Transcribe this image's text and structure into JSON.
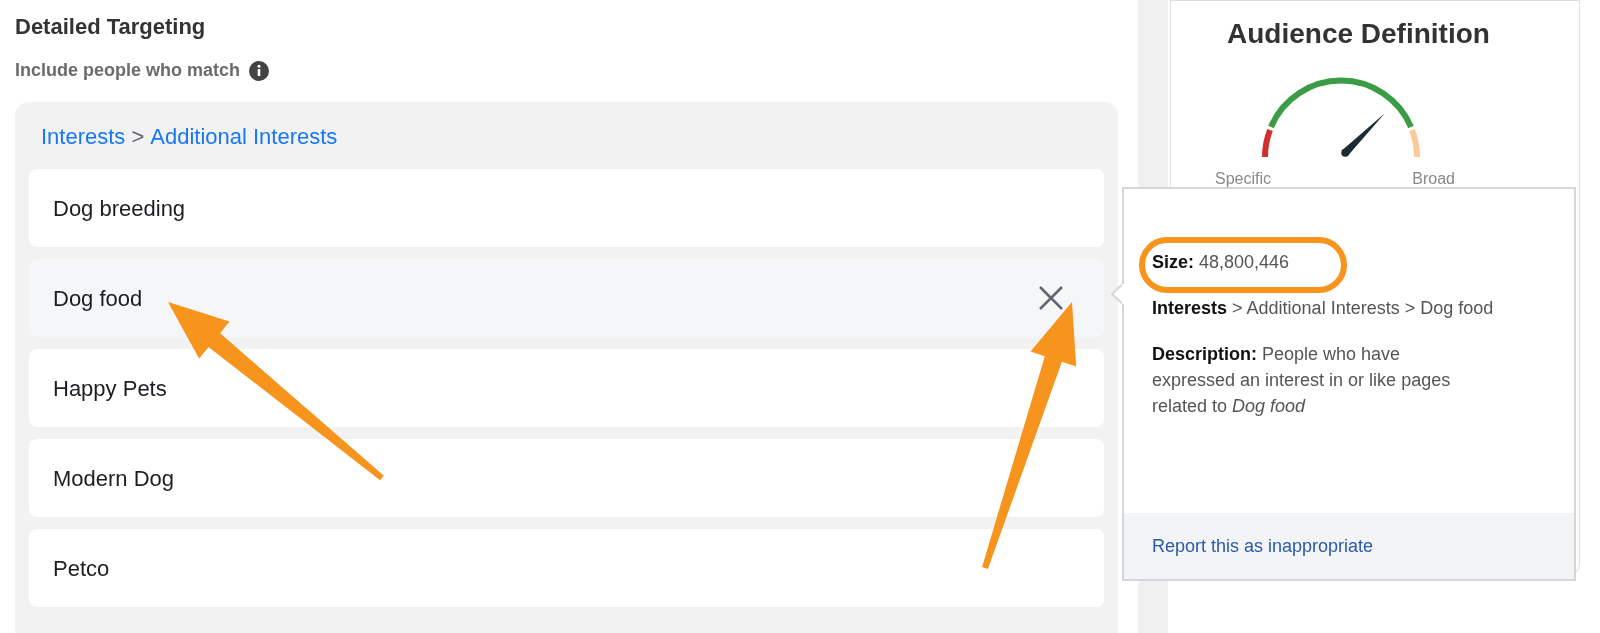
{
  "targeting": {
    "title": "Detailed Targeting",
    "subtitle": "Include people who match",
    "breadcrumb": {
      "parts": [
        "Interests",
        "Additional Interests"
      ],
      "separator": ">"
    },
    "items": [
      {
        "label": "Dog breeding",
        "highlighted": false
      },
      {
        "label": "Dog food",
        "highlighted": true
      },
      {
        "label": "Happy Pets",
        "highlighted": false
      },
      {
        "label": "Modern Dog",
        "highlighted": false
      },
      {
        "label": "Petco",
        "highlighted": false
      }
    ]
  },
  "audience": {
    "title": "Audience Definition",
    "gauge": {
      "low_label": "Specific",
      "high_label": "Broad"
    }
  },
  "tooltip": {
    "size": "**Size:** 48,800,446",
    "path": "**Interests** > Additional Interests > Dog food",
    "description": "**Description:** People who have expressed an interest in or like pages related to *Dog food*",
    "report_link": "Report this as inappropriate"
  }
}
